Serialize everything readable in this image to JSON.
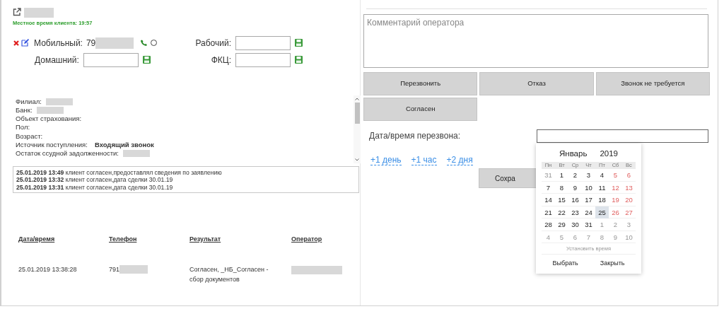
{
  "header": {
    "local_time": "Местное время клиента: 19:57",
    "name_redacted": true
  },
  "mobile": {
    "label": "Мобильный:",
    "value": "79",
    "value_redacted": true,
    "radio_checked": false
  },
  "phone_fields": [
    {
      "label": "Рабочий:"
    },
    {
      "label": "Домашний:"
    },
    {
      "label": "ФКЦ:"
    }
  ],
  "info": [
    {
      "label": "Филиал:",
      "redacted": true
    },
    {
      "label": "Банк:",
      "redacted": true
    },
    {
      "label": "Объект страхования:",
      "redacted": false
    },
    {
      "label": "Пол:",
      "redacted": false
    },
    {
      "label": "Возраст:",
      "redacted": false
    },
    {
      "label": "Источник поступления:",
      "value": "Входящий звонок",
      "redacted": false
    },
    {
      "label": "Остаток ссудной задолженности:",
      "redacted": true
    }
  ],
  "notes": [
    {
      "time": "25.01.2019 13:49",
      "text": "клиент согласен,предоставлял сведения по заявлению"
    },
    {
      "time": "25.01.2019 13:32",
      "text": "клиент согласен,дата сделки 30.01.19"
    },
    {
      "time": "25.01.2019 13:31",
      "text": "клиент согласен,дата сделки 30.01.19"
    }
  ],
  "history": {
    "columns": [
      "Дата/время",
      "Телефон",
      "Результат",
      "Оператор"
    ],
    "rows": [
      {
        "datetime": "25.01.2019 13:38:28",
        "phone": "791",
        "phone_redacted": true,
        "result": "Согласен, _НБ_Согласен - сбор документов",
        "operator_redacted": true
      }
    ]
  },
  "comment": {
    "placeholder": "Комментарий оператора"
  },
  "result_buttons": [
    "Перезвонить",
    "Отказ",
    "Звонок не требуется",
    "Согласен"
  ],
  "callback": {
    "label": "Дата/время перезвона:",
    "quick_links": [
      "+1 день",
      "+1 час",
      "+2 дня"
    ],
    "save_button": "Сохра"
  },
  "calendar": {
    "month": "Январь",
    "year": "2019",
    "weekdays": [
      "Пн",
      "Вт",
      "Ср",
      "Чт",
      "Пт",
      "Сб",
      "Вс"
    ],
    "weeks": [
      [
        {
          "day": "31",
          "muted": true,
          "selected": false
        },
        {
          "day": "1",
          "muted": false,
          "weekend": false,
          "selected": false
        },
        {
          "day": "2",
          "muted": false,
          "weekend": false,
          "selected": false
        },
        {
          "day": "3",
          "muted": false,
          "weekend": false,
          "selected": false
        },
        {
          "day": "4",
          "muted": false,
          "weekend": false,
          "selected": false
        },
        {
          "day": "5",
          "muted": false,
          "weekend": true,
          "selected": false
        },
        {
          "day": "6",
          "muted": false,
          "weekend": true,
          "selected": false
        }
      ],
      [
        {
          "day": "7",
          "muted": false,
          "weekend": false,
          "selected": false
        },
        {
          "day": "8",
          "muted": false,
          "weekend": false,
          "selected": false
        },
        {
          "day": "9",
          "muted": false,
          "weekend": false,
          "selected": false
        },
        {
          "day": "10",
          "muted": false,
          "weekend": false,
          "selected": false
        },
        {
          "day": "11",
          "muted": false,
          "weekend": false,
          "selected": false
        },
        {
          "day": "12",
          "muted": false,
          "weekend": true,
          "selected": false
        },
        {
          "day": "13",
          "muted": false,
          "weekend": true,
          "selected": false
        }
      ],
      [
        {
          "day": "14",
          "muted": false,
          "weekend": false,
          "selected": false
        },
        {
          "day": "15",
          "muted": false,
          "weekend": false,
          "selected": false
        },
        {
          "day": "16",
          "muted": false,
          "weekend": false,
          "selected": false
        },
        {
          "day": "17",
          "muted": false,
          "weekend": false,
          "selected": false
        },
        {
          "day": "18",
          "muted": false,
          "weekend": false,
          "selected": false
        },
        {
          "day": "19",
          "muted": false,
          "weekend": true,
          "selected": false
        },
        {
          "day": "20",
          "muted": false,
          "weekend": true,
          "selected": false
        }
      ],
      [
        {
          "day": "21",
          "muted": false,
          "weekend": false,
          "selected": false
        },
        {
          "day": "22",
          "muted": false,
          "weekend": false,
          "selected": false
        },
        {
          "day": "23",
          "muted": false,
          "weekend": false,
          "selected": false
        },
        {
          "day": "24",
          "muted": false,
          "weekend": false,
          "selected": false
        },
        {
          "day": "25",
          "muted": false,
          "weekend": false,
          "selected": true
        },
        {
          "day": "26",
          "muted": false,
          "weekend": true,
          "selected": false
        },
        {
          "day": "27",
          "muted": false,
          "weekend": true,
          "selected": false
        }
      ],
      [
        {
          "day": "28",
          "muted": false,
          "weekend": false,
          "selected": false
        },
        {
          "day": "29",
          "muted": false,
          "weekend": false,
          "selected": false
        },
        {
          "day": "30",
          "muted": false,
          "weekend": false,
          "selected": false
        },
        {
          "day": "31",
          "muted": false,
          "weekend": false,
          "selected": false
        },
        {
          "day": "1",
          "muted": true,
          "selected": false
        },
        {
          "day": "2",
          "muted": true,
          "selected": false
        },
        {
          "day": "3",
          "muted": true,
          "selected": false
        }
      ],
      [
        {
          "day": "4",
          "muted": true,
          "selected": false
        },
        {
          "day": "5",
          "muted": true,
          "selected": false
        },
        {
          "day": "6",
          "muted": true,
          "selected": false
        },
        {
          "day": "7",
          "muted": true,
          "selected": false
        },
        {
          "day": "8",
          "muted": true,
          "selected": false
        },
        {
          "day": "9",
          "muted": true,
          "selected": false
        },
        {
          "day": "10",
          "muted": true,
          "selected": false
        }
      ]
    ],
    "set_time": "Установить время",
    "buttons": [
      "Выбрать",
      "Закрыть"
    ]
  }
}
